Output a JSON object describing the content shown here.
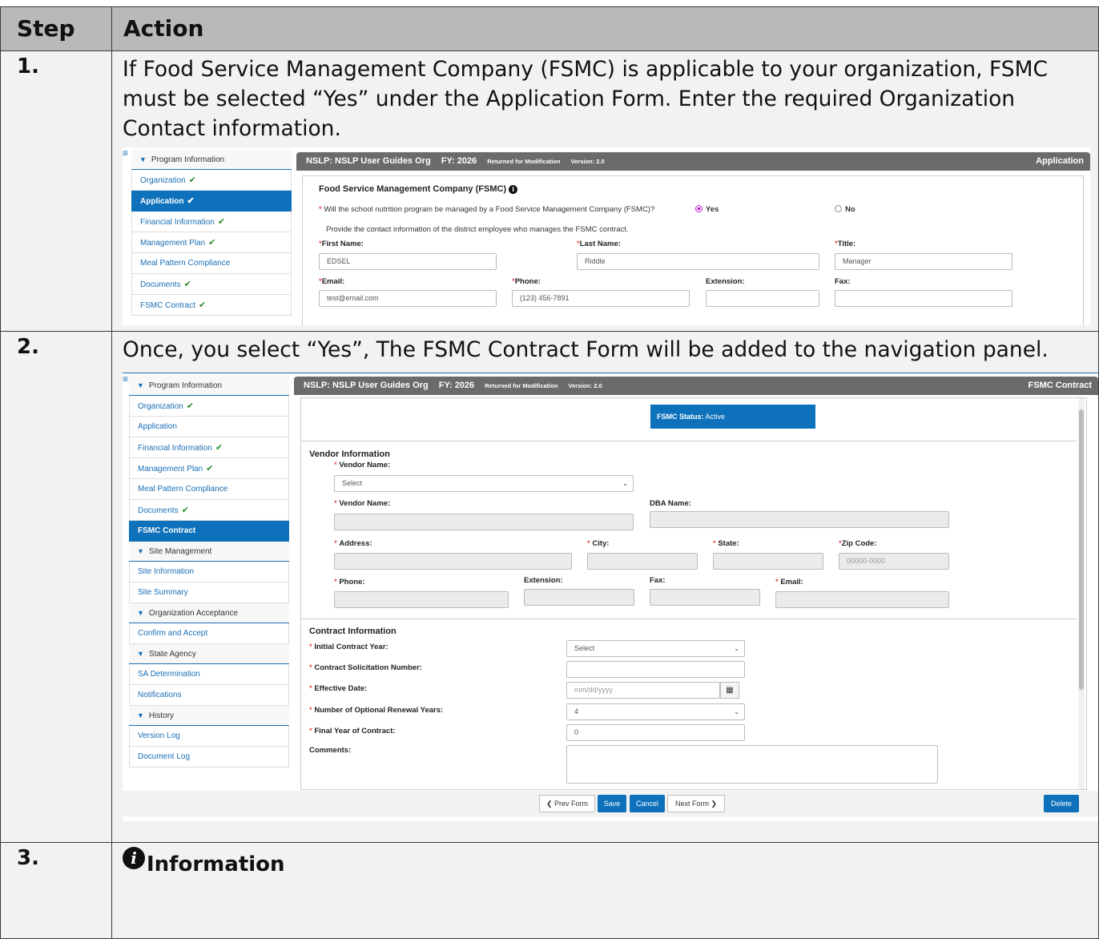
{
  "table": {
    "head_step": "Step",
    "head_action": "Action"
  },
  "steps": [
    {
      "number": "1.",
      "text": "If Food Service Management Company (FSMC) is applicable to your organization, FSMC must be selected “Yes” under the Application Form. Enter the required Organization Contact information."
    },
    {
      "number": "2.",
      "text": "Once, you select “Yes”, The FSMC Contract Form will be added to the navigation panel."
    },
    {
      "number": "3.",
      "info_title": "Information"
    }
  ],
  "shot1": {
    "nav_section": "Program Information",
    "nav_items": [
      {
        "label": "Organization",
        "check": "✔"
      },
      {
        "label": "Application",
        "check": "✔"
      },
      {
        "label": "Financial Information",
        "check": "✔"
      },
      {
        "label": "Management Plan",
        "check": "✔"
      },
      {
        "label": "Meal Pattern Compliance",
        "check": ""
      },
      {
        "label": "Documents",
        "check": "✔"
      },
      {
        "label": "FSMC Contract",
        "check": "✔"
      }
    ],
    "header": {
      "org": "NSLP: NSLP User Guides Org",
      "fy": "FY: 2026",
      "status": "Returned for Modification",
      "version": "Version: 2.0",
      "form": "Application"
    },
    "section_title": "Food Service Management Company (FSMC)",
    "question": "Will the school nutrition program be managed by a Food Service Management Company (FSMC)?",
    "yes": "Yes",
    "no": "No",
    "provide_text": "Provide the contact information of the district employee who manages the FSMC contract.",
    "first_name_label": "First Name:",
    "first_name": "EDSEL",
    "last_name_label": "Last Name:",
    "last_name": "Riddle",
    "title_label": "Title:",
    "title": "Manager",
    "email_label": "Email:",
    "email": "test@email.com",
    "phone_label": "Phone:",
    "phone": "(123) 456-7891",
    "extension_label": "Extension:",
    "fax_label": "Fax:"
  },
  "shot2": {
    "nav": {
      "program_information": "Program Information",
      "program_items": [
        {
          "label": "Organization",
          "check": "✔"
        },
        {
          "label": "Application",
          "check": ""
        },
        {
          "label": "Financial Information",
          "check": "✔"
        },
        {
          "label": "Management Plan",
          "check": "✔"
        },
        {
          "label": "Meal Pattern Compliance",
          "check": ""
        },
        {
          "label": "Documents",
          "check": "✔"
        },
        {
          "label": "FSMC Contract",
          "check": ""
        }
      ],
      "site_management": "Site Management",
      "site_items": [
        "Site Information",
        "Site Summary"
      ],
      "org_acceptance": "Organization Acceptance",
      "org_items": [
        "Confirm and Accept"
      ],
      "state_agency": "State Agency",
      "state_items": [
        "SA Determination",
        "Notifications"
      ],
      "history": "History",
      "history_items": [
        "Version Log",
        "Document Log"
      ]
    },
    "header": {
      "org": "NSLP: NSLP User Guides Org",
      "fy": "FY: 2026",
      "status": "Returned for Modification",
      "version": "Version: 2.0",
      "form": "FSMC Contract"
    },
    "fsmc_status_label": "FSMC Status:",
    "fsmc_status_value": "Active",
    "vendor_section": "Vendor Information",
    "vendor_name_label": "Vendor Name:",
    "vendor_select": "Select",
    "vendor_name_label2": "Vendor Name:",
    "dba_name_label": "DBA Name:",
    "address_label": "Address:",
    "city_label": "City:",
    "state_label": "State:",
    "zip_label": "Zip Code:",
    "zip_placeholder": "00000-0000",
    "phone_label": "Phone:",
    "extension_label": "Extension:",
    "fax_label": "Fax:",
    "email_label": "Email:",
    "contract_section": "Contract Information",
    "initial_year_label": "Initial Contract Year:",
    "initial_year_value": "Select",
    "solicitation_label": "Contract Solicitation Number:",
    "effective_date_label": "Effective Date:",
    "effective_date_placeholder": "mm/dd/yyyy",
    "renewal_label": "Number of Optional Renewal Years:",
    "renewal_value": "4",
    "final_year_label": "Final Year of Contract:",
    "final_year_value": "0",
    "comments_label": "Comments:",
    "buttons": {
      "prev": "Prev Form",
      "save": "Save",
      "cancel": "Cancel",
      "next": "Next Form",
      "delete": "Delete"
    }
  }
}
